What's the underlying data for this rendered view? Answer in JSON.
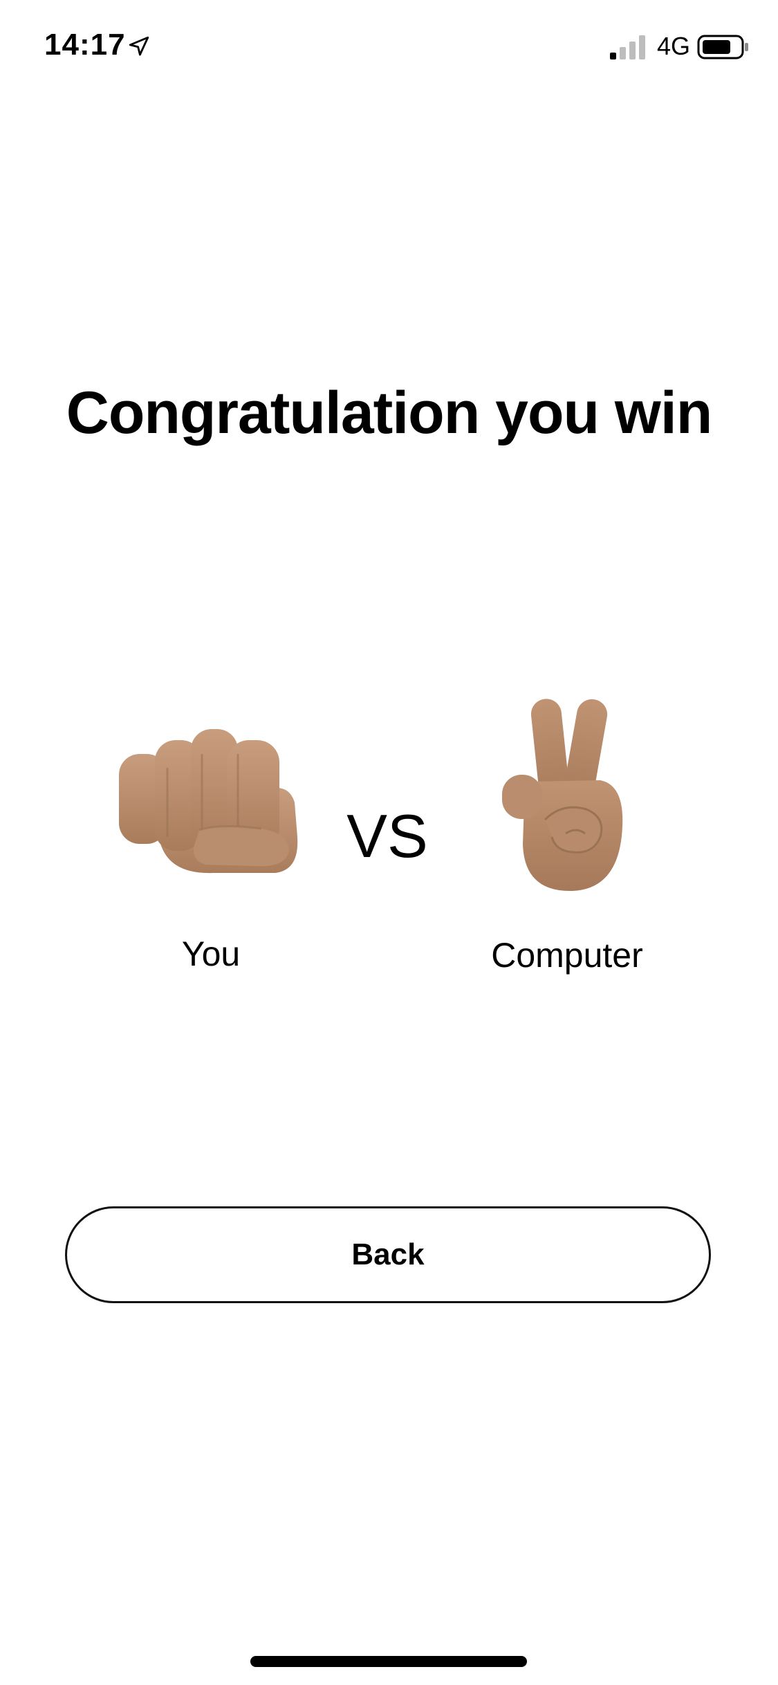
{
  "status_bar": {
    "time": "14:17",
    "network": "4G",
    "location_icon": "location-arrow-icon",
    "signal_icon": "cellular-signal-icon",
    "battery_icon": "battery-icon"
  },
  "result": {
    "title": "Congratulation you win",
    "vs_label": "VS",
    "player": {
      "label": "You",
      "choice_icon": "fist-icon"
    },
    "computer": {
      "label": "Computer",
      "choice_icon": "victory-hand-icon"
    }
  },
  "actions": {
    "back_label": "Back"
  },
  "colors": {
    "background": "#ffffff",
    "text": "#000000",
    "skin": "#b58a6a",
    "skin_shadow": "#9a7355"
  }
}
